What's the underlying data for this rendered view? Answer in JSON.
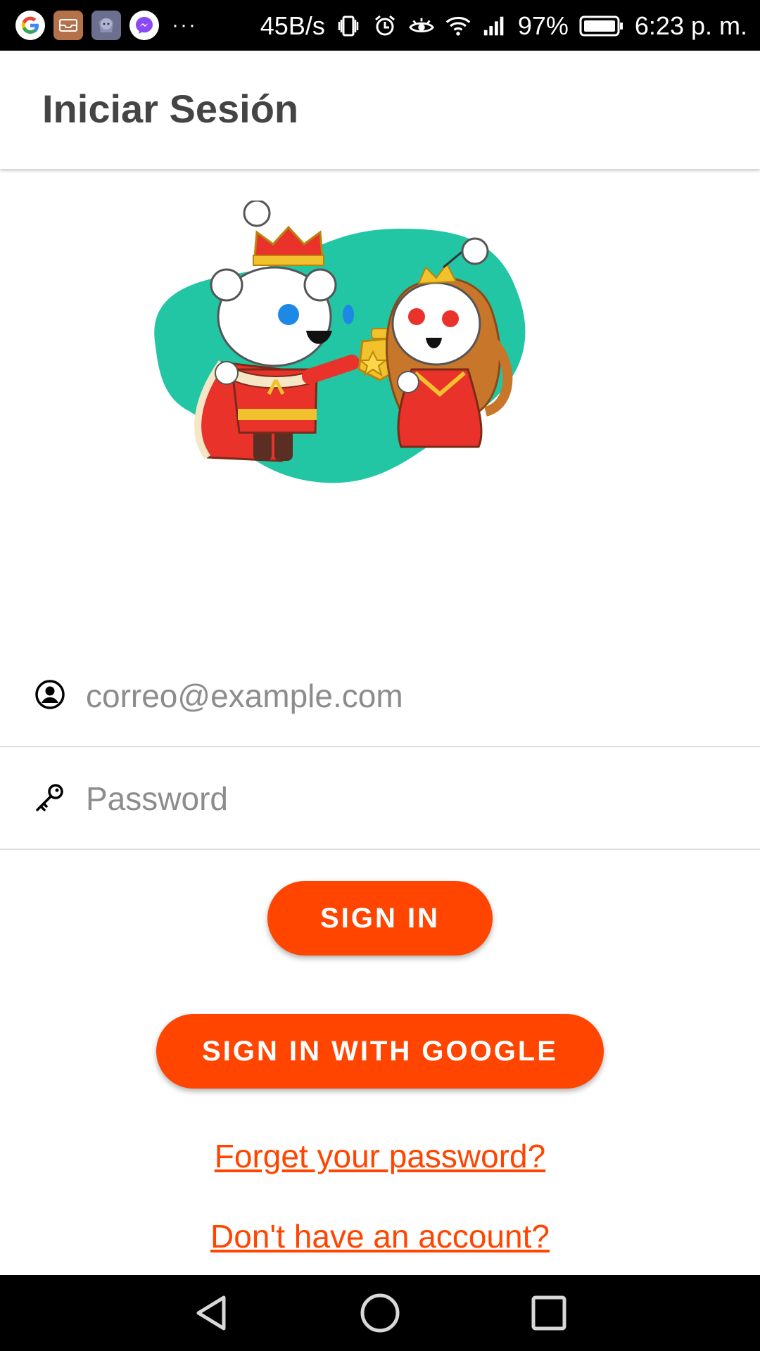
{
  "status_bar": {
    "speed": "45B/s",
    "battery": "97%",
    "time": "6:23 p. m.",
    "more": "···"
  },
  "app_bar": {
    "title": "Iniciar Sesión"
  },
  "form": {
    "email_placeholder": "correo@example.com",
    "password_placeholder": "Password",
    "sign_in_label": "SIGN IN",
    "google_label": "SIGN IN WITH GOOGLE"
  },
  "links": {
    "forgot": "Forget your password?",
    "account": "Don't have an account?"
  },
  "colors": {
    "accent": "#ff4500",
    "title": "#444444"
  }
}
